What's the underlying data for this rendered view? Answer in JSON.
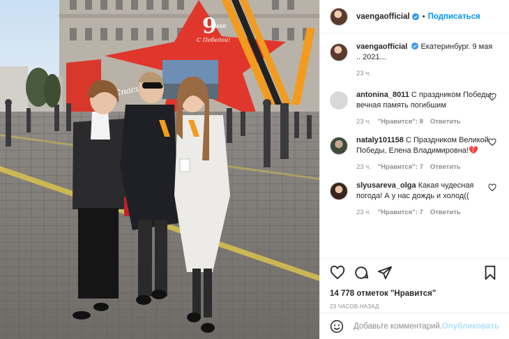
{
  "post": {
    "username": "vaengaofficial",
    "follow_label": "Подписаться",
    "dot": "•",
    "caption": "Екатеринбург. 9 мая .. 2021...",
    "caption_time": "23 ч.",
    "likes_label": "14 778 отметок \"Нравится\"",
    "posted_ago": "23 ЧАСОВ НАЗАД",
    "photo_sign": {
      "big_number": "9",
      "month": "мая",
      "script_line": "С Победой!",
      "left_script": "Спасибо"
    }
  },
  "comments": [
    {
      "username": "antonina_8011",
      "text": "С праздником Победы, вечная память погибшим",
      "time": "23 ч.",
      "likes": "\"Нравится\": 8",
      "reply": "Ответить"
    },
    {
      "username": "nataly101158",
      "text": "С Праздником Великой Победы, Елена Владимировна!💔",
      "time": "23 ч.",
      "likes": "\"Нравится\": 7",
      "reply": "Ответить"
    },
    {
      "username": "slyusareva_olga",
      "text": "Какая чудесная погода! А у нас дождь и холод((",
      "time": "23 ч.",
      "likes": "\"Нравится\": 7",
      "reply": "Ответить"
    }
  ],
  "composer": {
    "placeholder": "Добавьте комментарий...",
    "publish_label": "Опубликовать"
  },
  "colors": {
    "accent": "#0095f6",
    "publish_disabled": "#b2dffc",
    "star_red": "#e0362b",
    "ribbon_orange": "#f29b1f"
  }
}
